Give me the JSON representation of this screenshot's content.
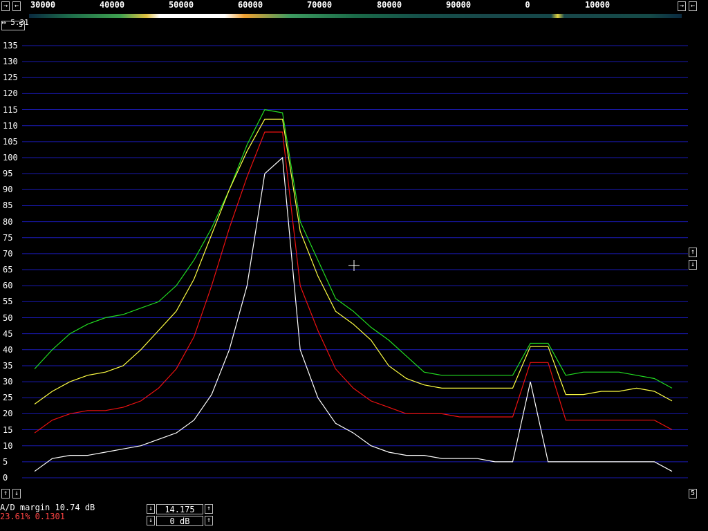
{
  "top_scale": {
    "labels": [
      "30000",
      "40000",
      "50000",
      "60000",
      "70000",
      "80000",
      "90000",
      "0",
      "10000"
    ]
  },
  "top_left_readout": "5.31",
  "top_left_box": "5",
  "left_arrows": {
    "left": "←",
    "right": "→"
  },
  "y_axis": {
    "labels": [
      "135",
      "130",
      "125",
      "120",
      "115",
      "110",
      "105",
      "100",
      "95",
      "90",
      "85",
      "80",
      "75",
      "70",
      "65",
      "60",
      "55",
      "50",
      "45",
      "40",
      "35",
      "30",
      "25",
      "20",
      "15",
      "10",
      "5",
      "0"
    ]
  },
  "status": {
    "ad_margin": "A/D margin 10.74 dB",
    "red_line": "23.61% 0.1301"
  },
  "center_box": {
    "freq": "14.175",
    "gain": "0 dB"
  },
  "right_box_label": "5",
  "colors": {
    "grid": "#1a1ab4",
    "green": "#22dd22",
    "yellow": "#ffff44",
    "red": "#ee1111",
    "white": "#ffffff"
  },
  "chart_data": {
    "type": "line",
    "ylim": [
      0,
      135
    ],
    "xlabel": "",
    "ylabel": "",
    "series": [
      {
        "color": "green",
        "values": [
          34,
          40,
          45,
          48,
          50,
          51,
          53,
          55,
          60,
          68,
          78,
          90,
          104,
          115,
          114,
          80,
          68,
          56,
          52,
          47,
          43,
          38,
          33,
          32,
          32,
          32,
          32,
          32,
          42,
          42,
          32,
          33,
          33,
          33,
          32,
          31,
          28
        ]
      },
      {
        "color": "yellow",
        "values": [
          23,
          27,
          30,
          32,
          33,
          35,
          40,
          46,
          52,
          62,
          76,
          90,
          102,
          112,
          112,
          77,
          63,
          52,
          48,
          43,
          35,
          31,
          29,
          28,
          28,
          28,
          28,
          28,
          41,
          41,
          26,
          26,
          27,
          27,
          28,
          27,
          24
        ]
      },
      {
        "color": "red",
        "values": [
          14,
          18,
          20,
          21,
          21,
          22,
          24,
          28,
          34,
          44,
          60,
          78,
          94,
          108,
          108,
          60,
          46,
          34,
          28,
          24,
          22,
          20,
          20,
          20,
          19,
          19,
          19,
          19,
          36,
          36,
          18,
          18,
          18,
          18,
          18,
          18,
          15
        ]
      },
      {
        "color": "white",
        "values": [
          2,
          6,
          7,
          7,
          8,
          9,
          10,
          12,
          14,
          18,
          26,
          40,
          60,
          95,
          100,
          40,
          25,
          17,
          14,
          10,
          8,
          7,
          7,
          6,
          6,
          6,
          5,
          5,
          30,
          5,
          5,
          5,
          5,
          5,
          5,
          5,
          2
        ]
      }
    ]
  }
}
